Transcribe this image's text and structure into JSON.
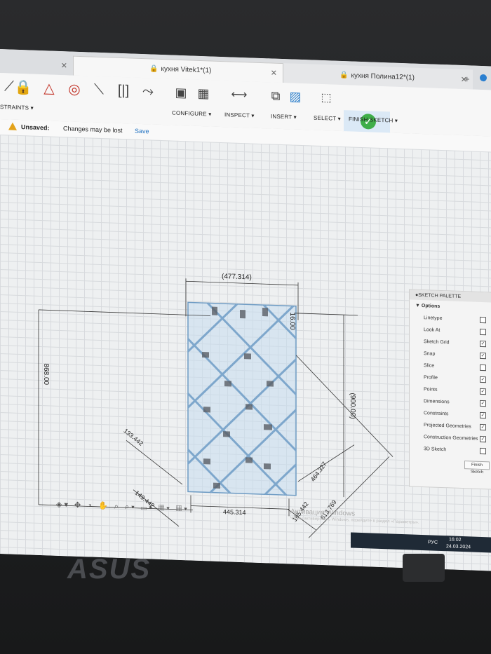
{
  "tabs": [
    {
      "label": ""
    },
    {
      "label": "кухня Vitek1*(1)"
    },
    {
      "label": "кухня Полина12*(1)"
    }
  ],
  "toolbar": {
    "constraints_label": "STRAINTS ▾",
    "configure_label": "CONFIGURE ▾",
    "inspect_label": "INSPECT ▾",
    "insert_label": "INSERT ▾",
    "select_label": "SELECT ▾",
    "finish_label": "FINISH SKETCH ▾"
  },
  "notice": {
    "title": "Unsaved:",
    "message": "Changes may be lost",
    "save_label": "Save"
  },
  "dimensions": {
    "top_width": "(477.314)",
    "small_top": "16.00",
    "left_height": "868.00",
    "right_height": "(900.00)",
    "diag_left_upper": "133.442",
    "diag_left_lower": "149.442",
    "bottom_width": "445.314",
    "diag_bottom": "165.442",
    "diag_right_inner": "464.327",
    "diag_right_outer": "613.769"
  },
  "palette": {
    "title": "SKETCH PALETTE",
    "section": "▼ Options",
    "options": [
      {
        "label": "Linetype",
        "checked": ""
      },
      {
        "label": "Look At",
        "checked": ""
      },
      {
        "label": "Sketch Grid",
        "checked": "✓"
      },
      {
        "label": "Snap",
        "checked": "✓"
      },
      {
        "label": "Slice",
        "checked": ""
      },
      {
        "label": "Profile",
        "checked": "✓"
      },
      {
        "label": "Points",
        "checked": "✓"
      },
      {
        "label": "Dimensions",
        "checked": "✓"
      },
      {
        "label": "Constraints",
        "checked": "✓"
      },
      {
        "label": "Projected Geometries",
        "checked": "✓"
      },
      {
        "label": "Construction Geometries",
        "checked": "✓"
      },
      {
        "label": "3D Sketch",
        "checked": ""
      }
    ],
    "finish_label": "Finish Sketch"
  },
  "bottom_icons": "◈▾ ✥ ◔ ✋ ⌕ ⌕▾ ▭▾ ▦▾ ▦▾",
  "activation": {
    "title": "Активация Windows",
    "subtitle": "Чтобы активировать Windows, перейдите в раздел «Параметры»."
  },
  "taskbar": {
    "lang": "РУС",
    "time": "16:02",
    "date": "24.03.2024"
  },
  "laptop_brand": "ASUS"
}
